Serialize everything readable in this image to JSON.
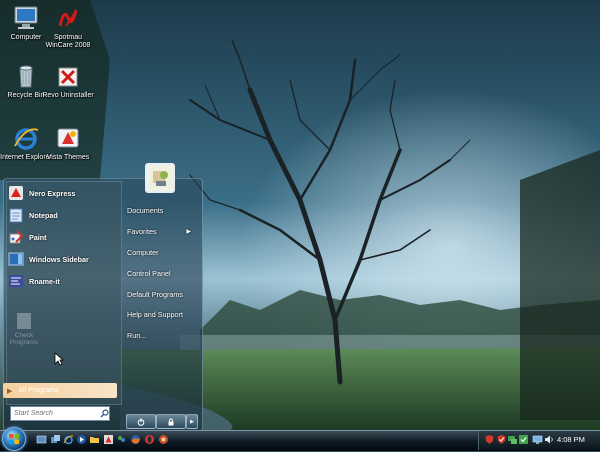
{
  "desktop": {
    "icons": [
      {
        "label": "Computer"
      },
      {
        "label": "Spotmau WinCare 2008"
      },
      {
        "label": "Recycle Bin"
      },
      {
        "label": "Revo Uninstaller"
      },
      {
        "label": "Internet Explorer"
      },
      {
        "label": "Vista Themes"
      }
    ]
  },
  "start_menu": {
    "pinned": [
      {
        "label": "Nero Express",
        "icon": "nero-icon"
      },
      {
        "label": "Notepad",
        "icon": "notepad-icon"
      },
      {
        "label": "Paint",
        "icon": "paint-icon"
      },
      {
        "label": "Windows Sidebar",
        "icon": "sidebar-icon"
      },
      {
        "label": "Rname-it",
        "icon": "rname-it-icon"
      }
    ],
    "faded_item": "Check Programs",
    "all_programs": "All Programs",
    "search_placeholder": "Start Search",
    "right_items": [
      {
        "label": "Documents"
      },
      {
        "label": "Favorites",
        "submenu": true
      },
      {
        "label": "Computer"
      },
      {
        "label": "Control Panel"
      },
      {
        "label": "Default Programs"
      },
      {
        "label": "Help and Support"
      },
      {
        "label": "Run..."
      }
    ]
  },
  "taskbar": {
    "clock": "4:08 PM",
    "quick_launch": [
      "show-desktop-icon",
      "switch-windows-icon",
      "internet-explorer-icon",
      "media-player-icon",
      "folder-icon",
      "nero-icon",
      "messenger-icon",
      "firefox-icon",
      "opera-icon"
    ],
    "tray_icons": [
      "security-icon",
      "shield-icon",
      "network-icon",
      "update-icon",
      "display-icon",
      "volume-icon"
    ]
  }
}
